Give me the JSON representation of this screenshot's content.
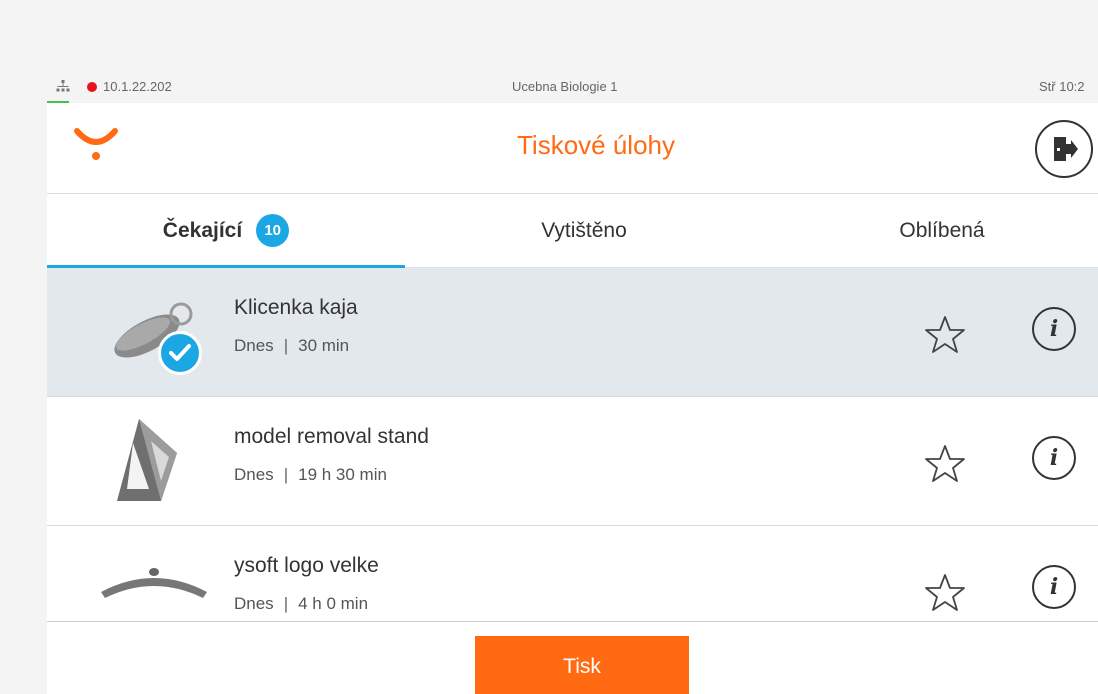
{
  "status": {
    "ip": "10.1.22.202",
    "room": "Ucebna Biologie 1",
    "time": "Stř 10:2",
    "dot_color": "#e8121b",
    "net_color": "#44c24d"
  },
  "header": {
    "title": "Tiskové úlohy",
    "accent": "#ff6a13"
  },
  "tabs": [
    {
      "label": "Čekající",
      "badge": "10",
      "active": true
    },
    {
      "label": "Vytištěno",
      "active": false
    },
    {
      "label": "Oblíbená",
      "active": false
    }
  ],
  "jobs": [
    {
      "name": "Klicenka kaja",
      "day": "Dnes",
      "duration": "30 min",
      "selected": true,
      "thumb": "keychain-model"
    },
    {
      "name": "model removal stand",
      "day": "Dnes",
      "duration": "19 h 30 min",
      "selected": false,
      "thumb": "stand-model"
    },
    {
      "name": "ysoft logo velke",
      "day": "Dnes",
      "duration": "4 h 0 min",
      "selected": false,
      "thumb": "logo-model"
    }
  ],
  "meta_separator": "|",
  "footer": {
    "print_label": "Tisk"
  },
  "icons": [
    "network-icon",
    "logo-icon",
    "exit-icon",
    "star-icon",
    "info-icon",
    "check-icon"
  ]
}
